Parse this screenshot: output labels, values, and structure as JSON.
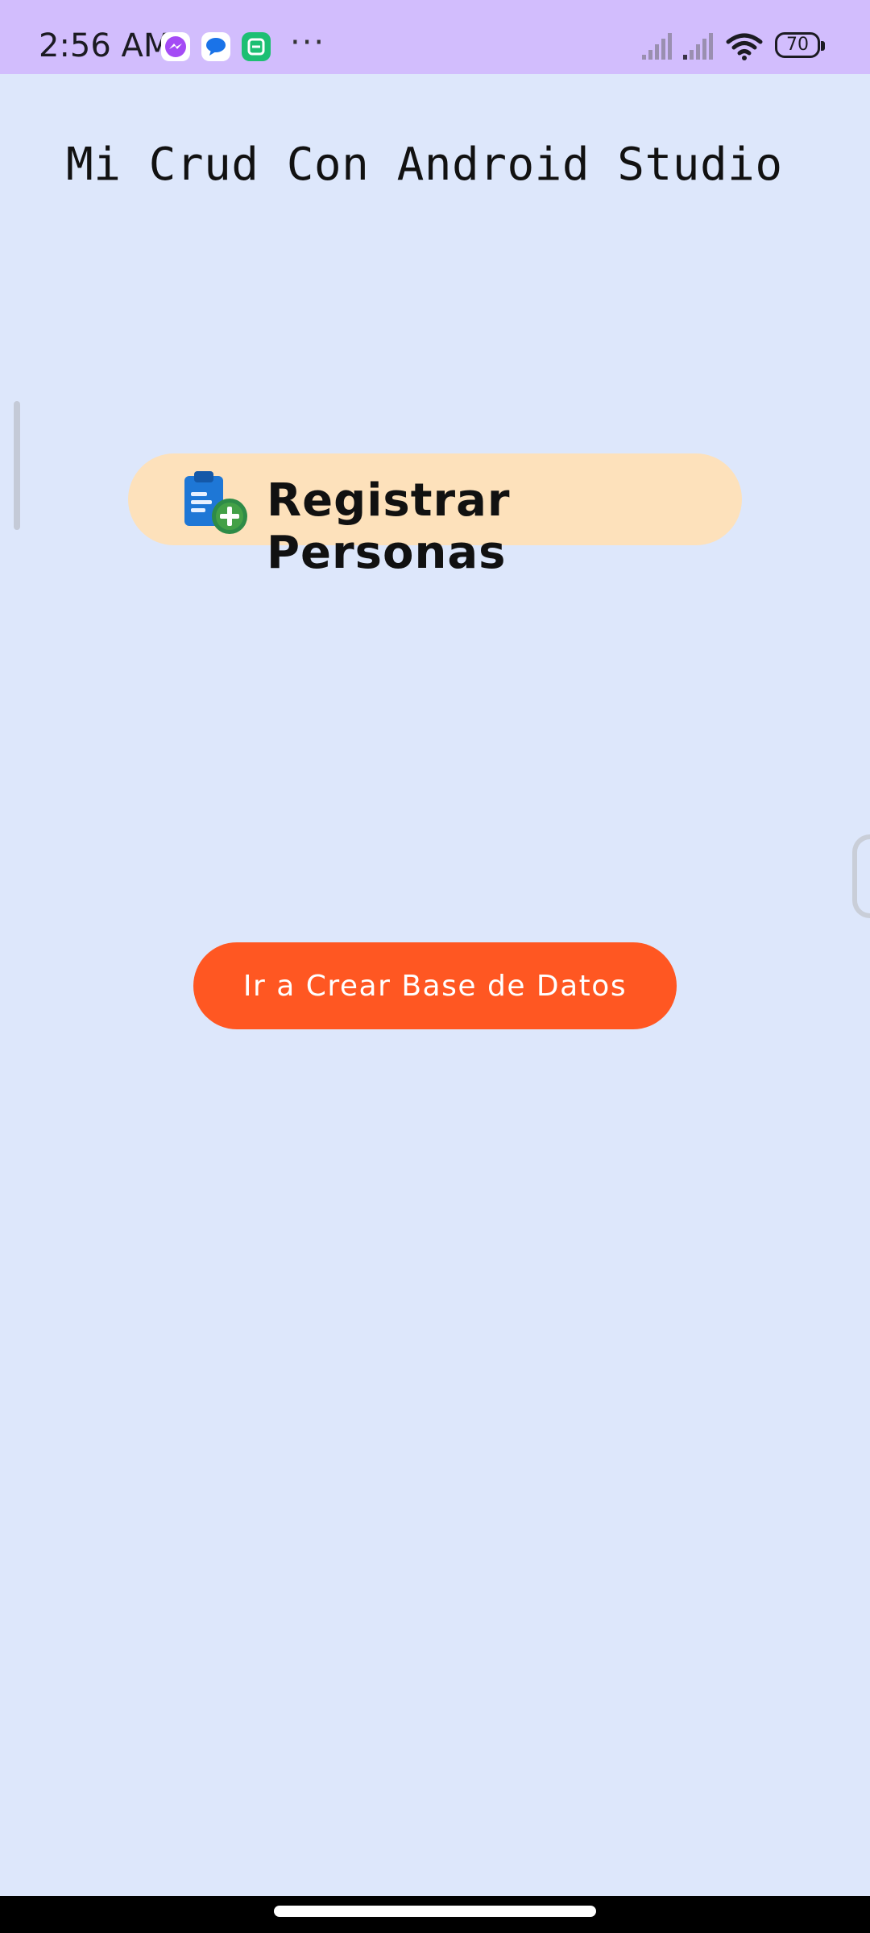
{
  "status_bar": {
    "time": "2:56 AM",
    "battery": "70",
    "more": "···",
    "notifications": [
      "messenger-icon",
      "chat-icon",
      "app-icon"
    ]
  },
  "app": {
    "title": "Mi Crud Con Android Studio"
  },
  "buttons": {
    "register_label": "Registrar Personas",
    "create_db_label": "Ir a Crear Base de Datos"
  },
  "colors": {
    "status_bar_bg": "#d2bdfd",
    "page_bg": "#dde7fb",
    "register_button_bg": "#fde1bb",
    "db_button_bg": "#ff5722"
  }
}
